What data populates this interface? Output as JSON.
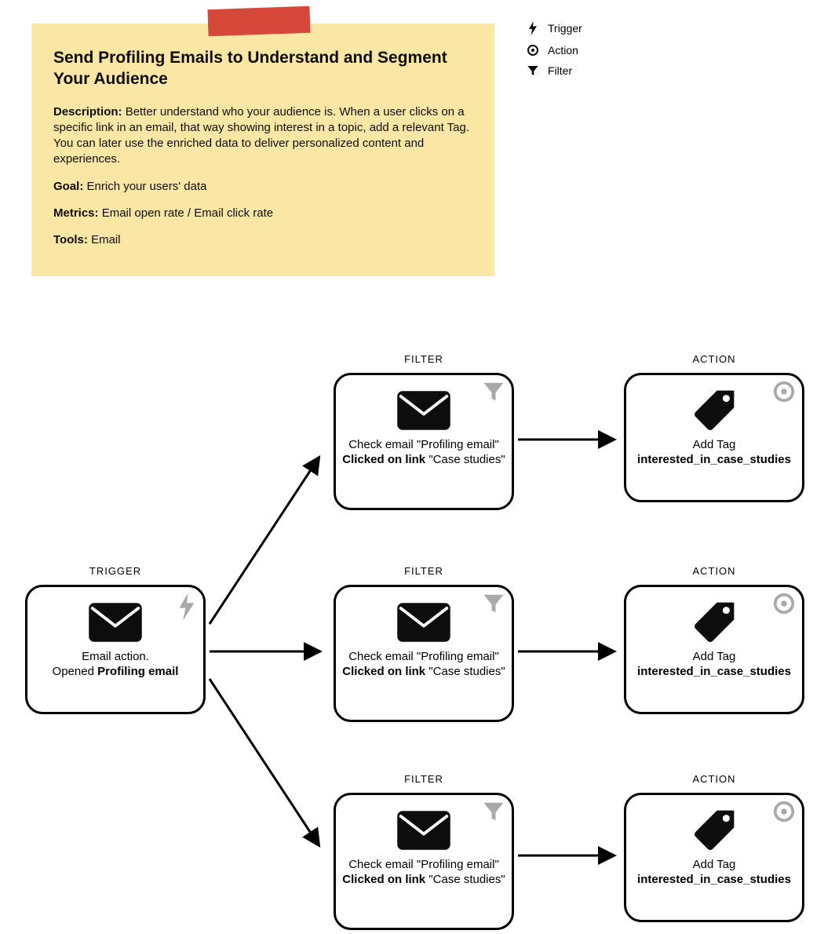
{
  "note": {
    "title": "Send Profiling Emails to Understand and Segment Your Audience",
    "description_label": "Description:",
    "description_text": "Better understand who your audience is. When a user clicks on a specific link in an email, that way showing interest in a topic, add a relevant Tag. You can later use the enriched data to deliver personalized content and experiences.",
    "goal_label": "Goal:",
    "goal_text": "Enrich your users' data",
    "metrics_label": "Metrics:",
    "metrics_text": "Email open rate / Email click rate",
    "tools_label": "Tools:",
    "tools_text": "Email"
  },
  "legend": {
    "trigger": "Trigger",
    "action": "Action",
    "filter": "Filter"
  },
  "headings": {
    "trigger": "TRIGGER",
    "filter": "FILTER",
    "action": "ACTION"
  },
  "trigger": {
    "line1": "Email action.",
    "line2a": "Opened ",
    "line2b": "Profiling email"
  },
  "filter": {
    "line1a": "Check email ",
    "line1b": "\"Profiling email\"",
    "line2a": "Clicked on link",
    "line2b": " \"Case studies\""
  },
  "action": {
    "line1": "Add Tag",
    "line2": "interested_in_case_studies"
  }
}
